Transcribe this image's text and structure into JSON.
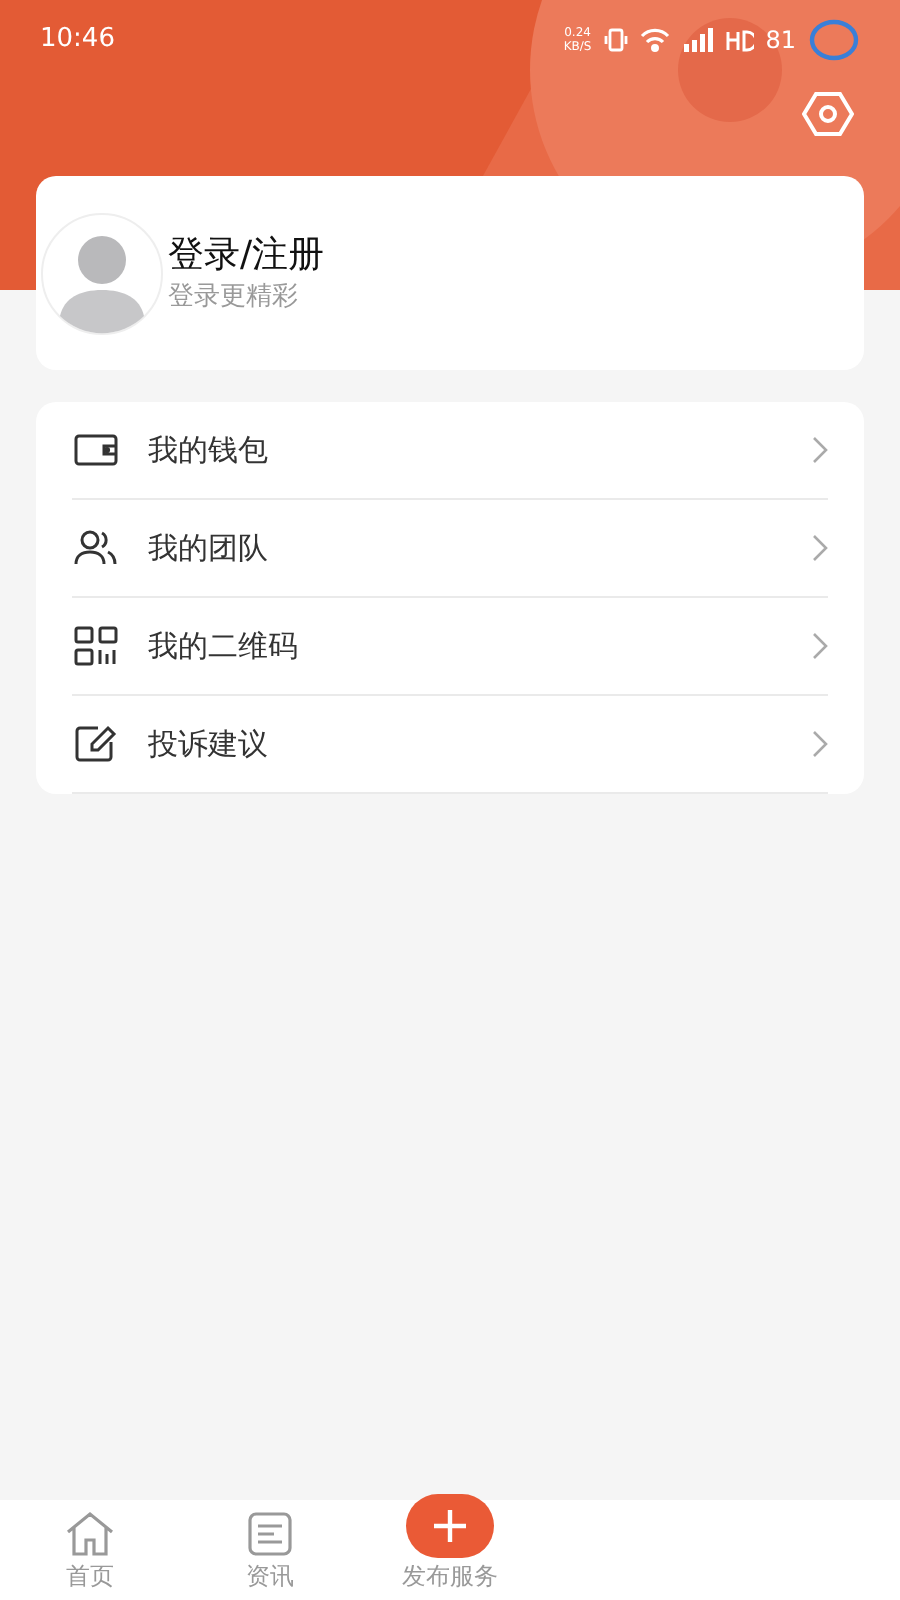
{
  "status_bar": {
    "time": "10:46",
    "net_speed": "0.24\nKB/S",
    "battery": "81"
  },
  "profile": {
    "title": "登录/注册",
    "subtitle": "登录更精彩"
  },
  "menu": [
    {
      "kind": "wallet",
      "label": "我的钱包"
    },
    {
      "kind": "team",
      "label": "我的团队"
    },
    {
      "kind": "qrcode",
      "label": "我的二维码"
    },
    {
      "kind": "feedback",
      "label": "投诉建议"
    }
  ],
  "tab_bar": [
    {
      "kind": "home",
      "label": "首页",
      "selected": false
    },
    {
      "kind": "news",
      "label": "资讯",
      "selected": false
    },
    {
      "kind": "publish",
      "label": "发布服务",
      "selected": false
    }
  ]
}
